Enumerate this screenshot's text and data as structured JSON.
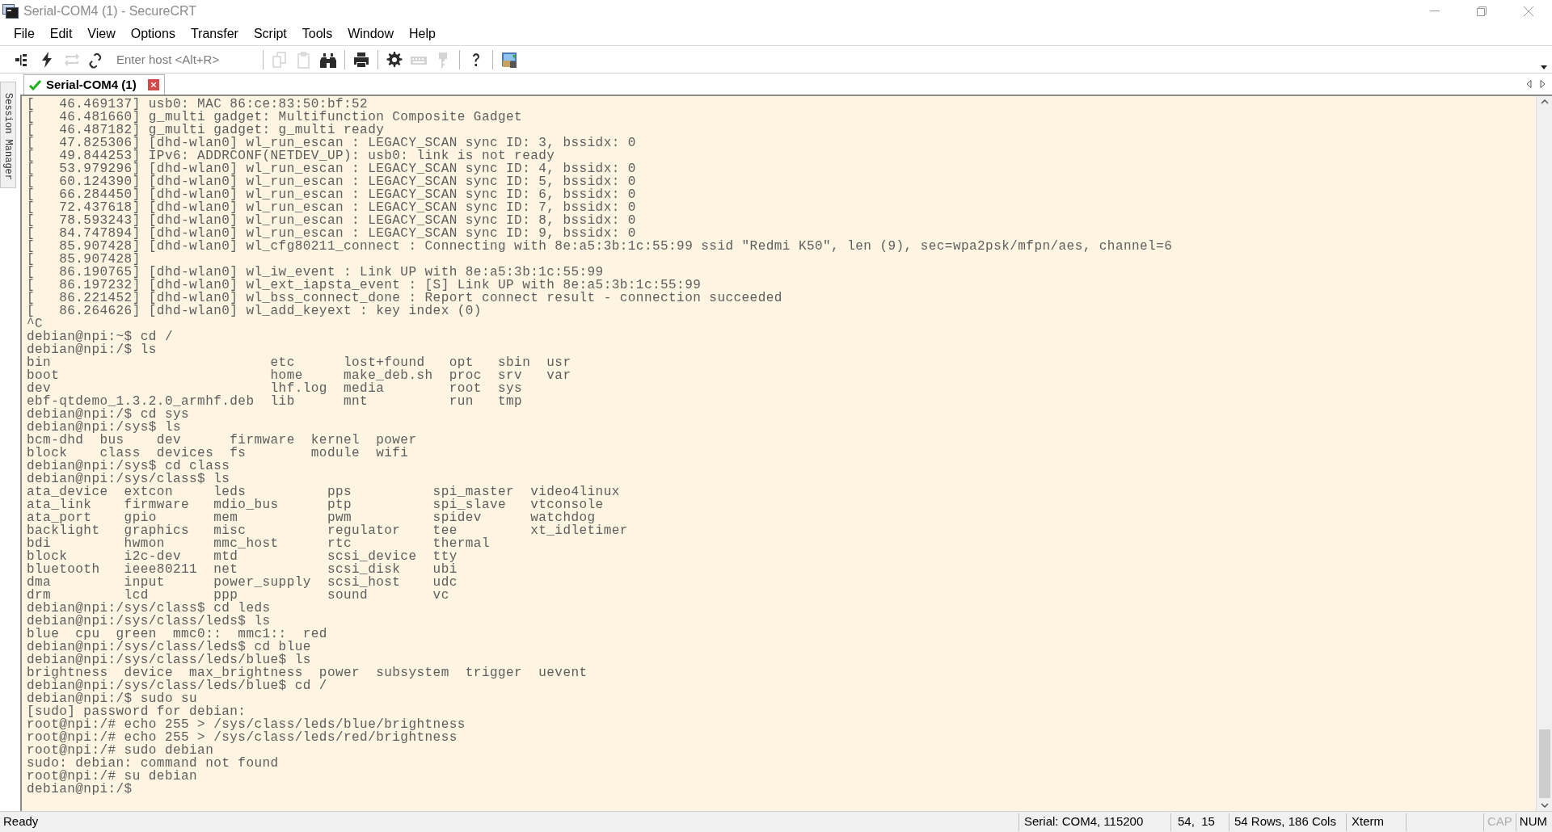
{
  "window": {
    "title": "Serial-COM4 (1) - SecureCRT"
  },
  "menu": [
    "File",
    "Edit",
    "View",
    "Options",
    "Transfer",
    "Script",
    "Tools",
    "Window",
    "Help"
  ],
  "toolbar": {
    "groups": [
      [
        {
          "kind": "sessions",
          "disabled": false
        },
        {
          "kind": "quick",
          "disabled": false
        },
        {
          "kind": "reconnect",
          "disabled": true
        },
        {
          "kind": "disconnect",
          "disabled": false
        }
      ],
      [
        {
          "kind": "copy",
          "disabled": true
        },
        {
          "kind": "paste",
          "disabled": true
        },
        {
          "kind": "find",
          "disabled": false
        }
      ],
      [
        {
          "kind": "print",
          "disabled": false
        }
      ],
      [
        {
          "kind": "options",
          "disabled": false
        },
        {
          "kind": "keymap",
          "disabled": true
        },
        {
          "kind": "keychain",
          "disabled": true
        }
      ],
      [
        {
          "kind": "help",
          "disabled": false
        }
      ],
      [
        {
          "kind": "screen",
          "disabled": false
        }
      ]
    ],
    "host_field": {
      "placeholder": "Enter host <Alt+R>"
    }
  },
  "sidebar_tab": {
    "label": "Session Manager"
  },
  "tabs": [
    {
      "label": "Serial-COM4 (1)",
      "selected": true,
      "connected": true
    }
  ],
  "terminal": {
    "lines": [
      "[   46.469137] usb0: MAC 86:ce:83:50:bf:52",
      "[   46.481660] g_multi gadget: Multifunction Composite Gadget",
      "[   46.487182] g_multi gadget: g_multi ready",
      "[   47.825306] [dhd-wlan0] wl_run_escan : LEGACY_SCAN sync ID: 3, bssidx: 0",
      "[   49.844253] IPv6: ADDRCONF(NETDEV_UP): usb0: link is not ready",
      "[   53.979296] [dhd-wlan0] wl_run_escan : LEGACY_SCAN sync ID: 4, bssidx: 0",
      "[   60.124390] [dhd-wlan0] wl_run_escan : LEGACY_SCAN sync ID: 5, bssidx: 0",
      "[   66.284450] [dhd-wlan0] wl_run_escan : LEGACY_SCAN sync ID: 6, bssidx: 0",
      "[   72.437618] [dhd-wlan0] wl_run_escan : LEGACY_SCAN sync ID: 7, bssidx: 0",
      "[   78.593243] [dhd-wlan0] wl_run_escan : LEGACY_SCAN sync ID: 8, bssidx: 0",
      "[   84.747894] [dhd-wlan0] wl_run_escan : LEGACY_SCAN sync ID: 9, bssidx: 0",
      "[   85.907428] [dhd-wlan0] wl_cfg80211_connect : Connecting with 8e:a5:3b:1c:55:99 ssid \"Redmi K50\", len (9), sec=wpa2psk/mfpn/aes, channel=6",
      "[   85.907428]",
      "[   86.190765] [dhd-wlan0] wl_iw_event : Link UP with 8e:a5:3b:1c:55:99",
      "[   86.197232] [dhd-wlan0] wl_ext_iapsta_event : [S] Link UP with 8e:a5:3b:1c:55:99",
      "[   86.221452] [dhd-wlan0] wl_bss_connect_done : Report connect result - connection succeeded",
      "[   86.264626] [dhd-wlan0] wl_add_keyext : key index (0)",
      "^C",
      "debian@npi:~$ cd /",
      "debian@npi:/$ ls",
      "bin                           etc      lost+found   opt   sbin  usr",
      "boot                          home     make_deb.sh  proc  srv   var",
      "dev                           lhf.log  media        root  sys",
      "ebf-qtdemo_1.3.2.0_armhf.deb  lib      mnt          run   tmp",
      "debian@npi:/$ cd sys",
      "debian@npi:/sys$ ls",
      "bcm-dhd  bus    dev      firmware  kernel  power",
      "block    class  devices  fs        module  wifi",
      "debian@npi:/sys$ cd class",
      "debian@npi:/sys/class$ ls",
      "ata_device  extcon     leds          pps          spi_master  video4linux",
      "ata_link    firmware   mdio_bus      ptp          spi_slave   vtconsole",
      "ata_port    gpio       mem           pwm          spidev      watchdog",
      "backlight   graphics   misc          regulator    tee         xt_idletimer",
      "bdi         hwmon      mmc_host      rtc          thermal",
      "block       i2c-dev    mtd           scsi_device  tty",
      "bluetooth   ieee80211  net           scsi_disk    ubi",
      "dma         input      power_supply  scsi_host    udc",
      "drm         lcd        ppp           sound        vc",
      "debian@npi:/sys/class$ cd leds",
      "debian@npi:/sys/class/leds$ ls",
      "blue  cpu  green  mmc0::  mmc1::  red",
      "debian@npi:/sys/class/leds$ cd blue",
      "debian@npi:/sys/class/leds/blue$ ls",
      "brightness  device  max_brightness  power  subsystem  trigger  uevent",
      "debian@npi:/sys/class/leds/blue$ cd /",
      "debian@npi:/$ sudo su",
      "[sudo] password for debian:",
      "root@npi:/# echo 255 > /sys/class/leds/blue/brightness",
      "root@npi:/# echo 255 > /sys/class/leds/red/brightness",
      "root@npi:/# sudo debian",
      "sudo: debian: command not found",
      "root@npi:/# su debian",
      "debian@npi:/$"
    ]
  },
  "status_bar": {
    "message": "Ready",
    "sections": [
      "Serial: COM4, 115200",
      "54,  15",
      "54 Rows, 186 Cols",
      "Xterm"
    ],
    "indicators": [
      {
        "label": "CAP",
        "on": false
      },
      {
        "label": "NUM",
        "on": true
      }
    ]
  }
}
